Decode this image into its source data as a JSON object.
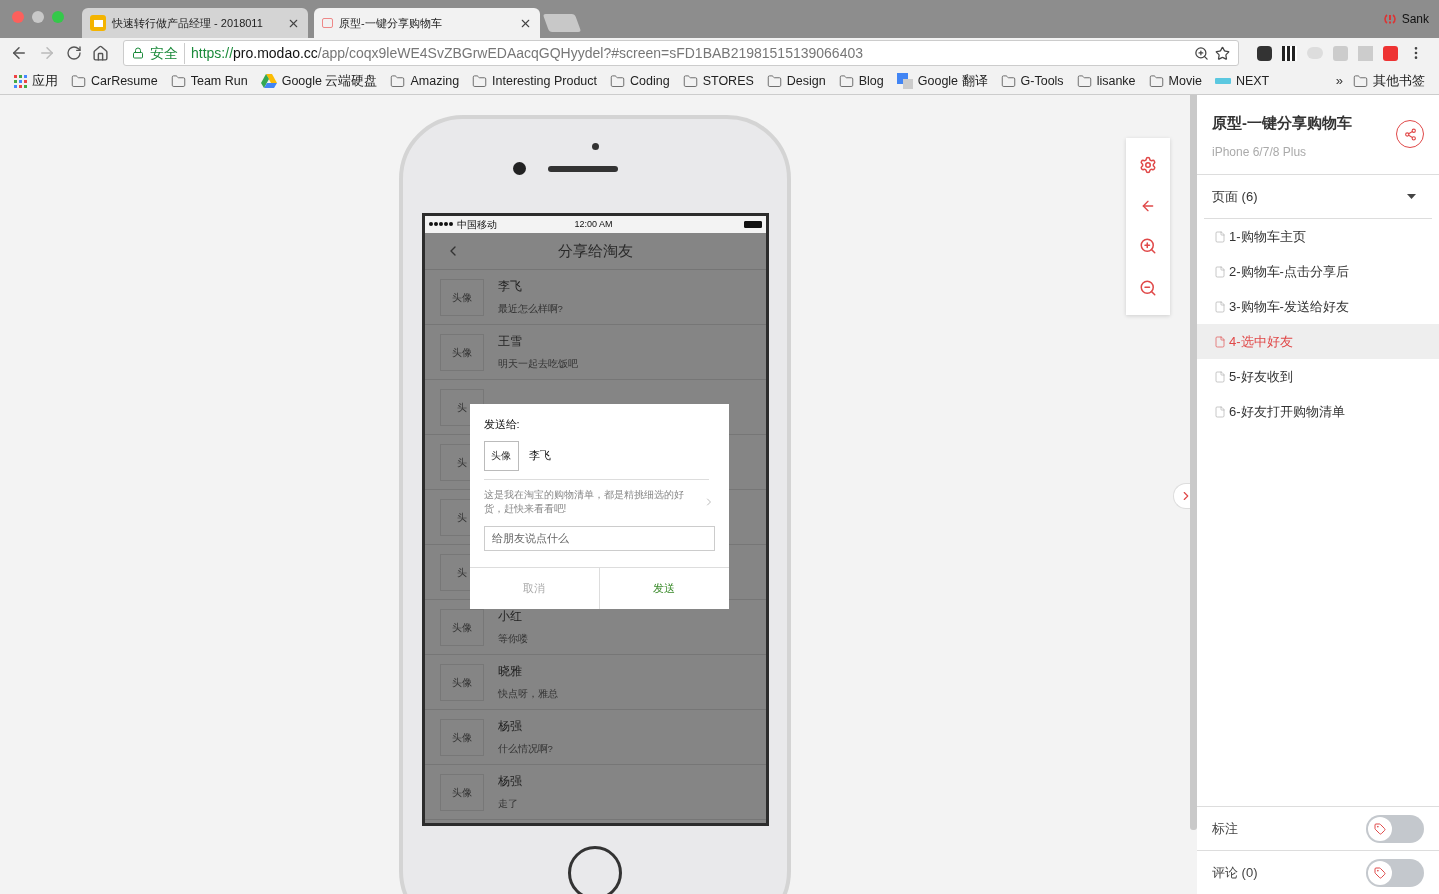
{
  "browser": {
    "tabs": [
      {
        "title": "快速转行做产品经理 - 2018011",
        "kind": "slides",
        "selected": false
      },
      {
        "title": "原型-一键分享购物车",
        "kind": "prototype",
        "selected": true
      }
    ],
    "profile": "Sank",
    "address": {
      "secure_label": "安全",
      "scheme": "https://",
      "host": "pro.modao.cc",
      "path": "/app/coqx9leWE4SvZBGrwEDAacqGQHyydel?#screen=sFD1BAB21981515139066403"
    },
    "bookmarks": [
      {
        "label": "应用",
        "kind": "apps"
      },
      {
        "label": "CarResume",
        "kind": "folder"
      },
      {
        "label": "Team Run",
        "kind": "folder"
      },
      {
        "label": "Google 云端硬盘",
        "kind": "drive"
      },
      {
        "label": "Amazing",
        "kind": "folder"
      },
      {
        "label": "Interesting Product",
        "kind": "folder"
      },
      {
        "label": "Coding",
        "kind": "folder"
      },
      {
        "label": "STORES",
        "kind": "folder"
      },
      {
        "label": "Design",
        "kind": "folder"
      },
      {
        "label": "Blog",
        "kind": "folder"
      },
      {
        "label": "Google 翻译",
        "kind": "translate"
      },
      {
        "label": "G-Tools",
        "kind": "folder"
      },
      {
        "label": "lisanke",
        "kind": "folder"
      },
      {
        "label": "Movie",
        "kind": "folder"
      },
      {
        "label": "NEXT",
        "kind": "next"
      }
    ],
    "overflow": "»",
    "other_bookmarks": "其他书签"
  },
  "phone": {
    "status": {
      "carrier": "中国移动",
      "time": "12:00 AM"
    },
    "nav_title": "分享给淘友",
    "contacts": [
      {
        "avatar": "头像",
        "name": "李飞",
        "message": "最近怎么样啊?"
      },
      {
        "avatar": "头像",
        "name": "王雪",
        "message": "明天一起去吃饭吧"
      },
      {
        "avatar": "头"
      },
      {
        "avatar": "头"
      },
      {
        "avatar": "头"
      },
      {
        "avatar": "头"
      },
      {
        "avatar": "头像",
        "name": "小红",
        "message": "等你喽"
      },
      {
        "avatar": "头像",
        "name": "晓雅",
        "message": "快点呀，雅总"
      },
      {
        "avatar": "头像",
        "name": "杨强",
        "message": "什么情况啊?"
      },
      {
        "avatar": "头像",
        "name": "杨强",
        "message": "走了"
      }
    ],
    "dialog": {
      "heading": "发送给:",
      "recipient_avatar": "头像",
      "recipient_name": "李飞",
      "card_text": "这是我在淘宝的购物清单，都是精挑细选的好货，赶快来看看吧!",
      "input_placeholder": "给朋友说点什么",
      "buttons": [
        {
          "label": "取消",
          "kind": "cancel"
        },
        {
          "label": "发送",
          "kind": "confirm"
        }
      ]
    }
  },
  "sidebar": {
    "title": "原型-一键分享购物车",
    "device": "iPhone 6/7/8 Plus",
    "pages_header": "页面 (6)",
    "pages": [
      {
        "label": "1-购物车主页",
        "selected": false
      },
      {
        "label": "2-购物车-点击分享后",
        "selected": false
      },
      {
        "label": "3-购物车-发送给好友",
        "selected": false
      },
      {
        "label": "4-选中好友",
        "selected": true
      },
      {
        "label": "5-好友收到",
        "selected": false
      },
      {
        "label": "6-好友打开购物清单",
        "selected": false
      }
    ],
    "toggles": [
      {
        "label": "标注",
        "on": false
      },
      {
        "label": "评论 (0)",
        "on": false
      }
    ]
  }
}
